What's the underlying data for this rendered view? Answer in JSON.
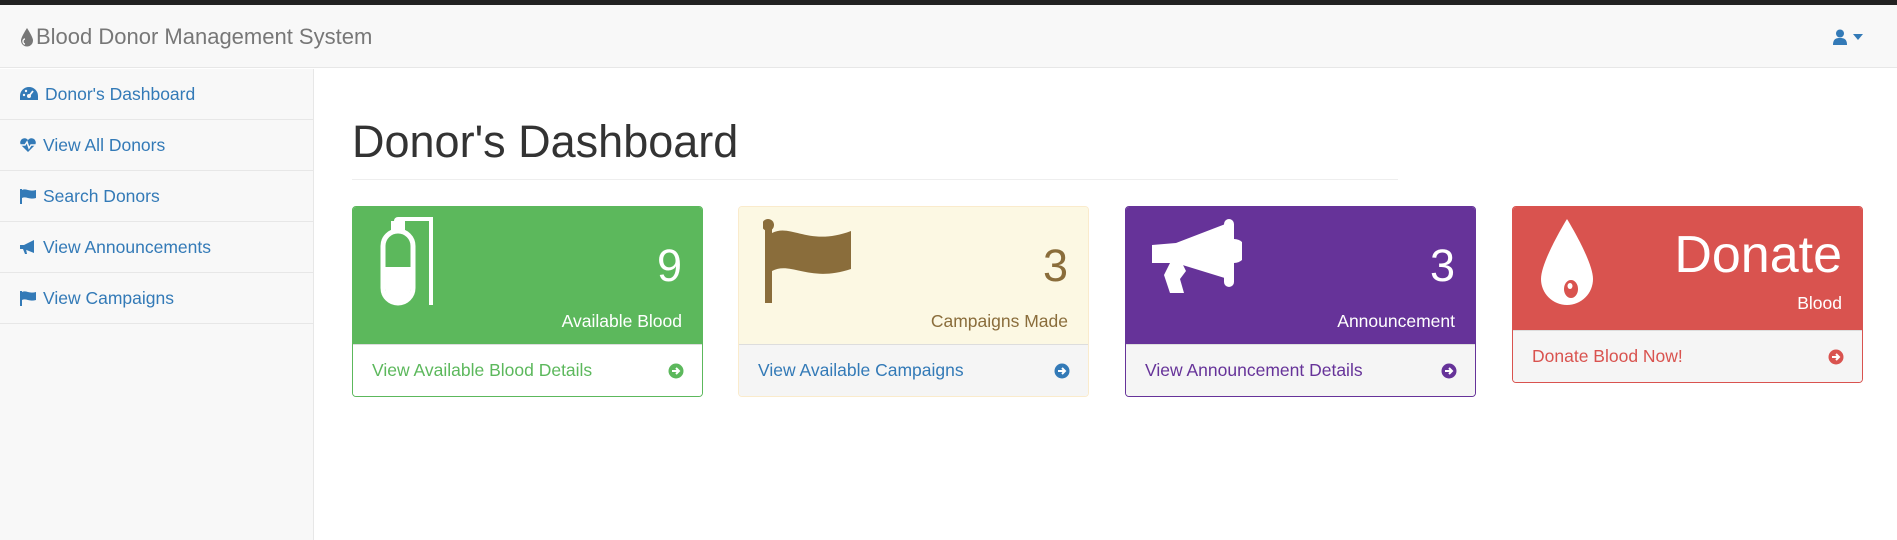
{
  "app": {
    "title": "Blood Donor Management System"
  },
  "sidebar": {
    "items": [
      {
        "label": "Donor's Dashboard",
        "icon": "dashboard-icon"
      },
      {
        "label": "View All Donors",
        "icon": "heartbeat-icon"
      },
      {
        "label": "Search Donors",
        "icon": "flag-icon"
      },
      {
        "label": "View Announcements",
        "icon": "bullhorn-icon"
      },
      {
        "label": "View Campaigns",
        "icon": "flag-icon"
      }
    ]
  },
  "main": {
    "title": "Donor's Dashboard",
    "panels": [
      {
        "value": "9",
        "label": "Available Blood",
        "link": "View Available Blood Details",
        "icon": "blood-bag-icon",
        "color": "#5cb85c"
      },
      {
        "value": "3",
        "label": "Campaigns Made",
        "link": "View Available Campaigns",
        "icon": "flag-icon",
        "color": "#8a6d3b"
      },
      {
        "value": "3",
        "label": "Announcement",
        "link": "View Announcement Details",
        "icon": "bullhorn-icon",
        "color": "#663399"
      },
      {
        "value": "Donate",
        "label": "Blood",
        "link": "Donate Blood Now!",
        "icon": "blood-drop-icon",
        "color": "#d9534f"
      }
    ]
  }
}
